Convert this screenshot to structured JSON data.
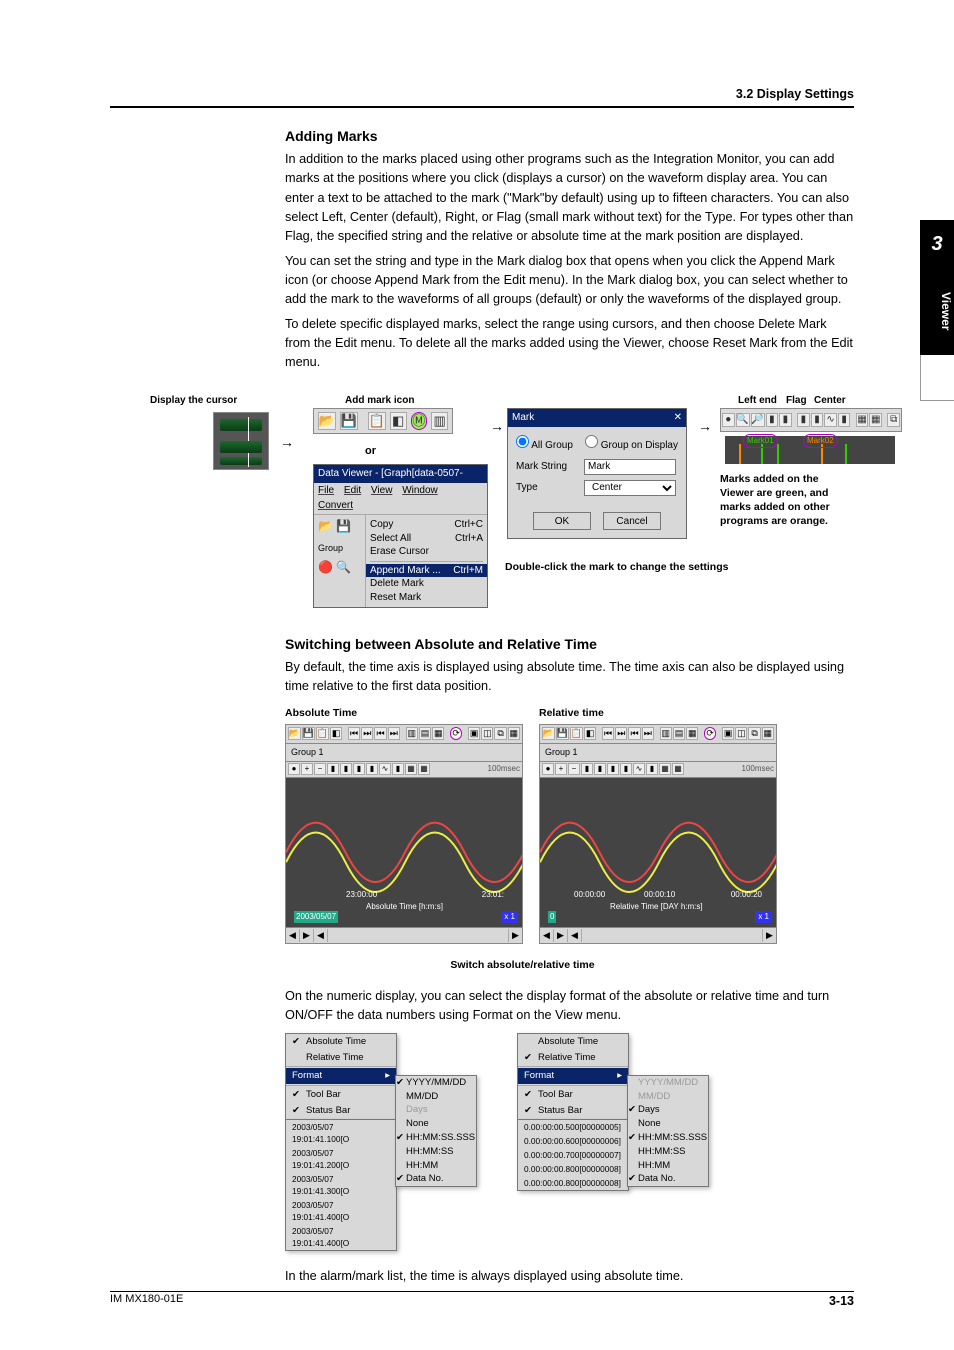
{
  "breadcrumb": "3.2  Display Settings",
  "chapter_tab": {
    "number": "3",
    "label": "Viewer"
  },
  "section1": {
    "heading": "Adding Marks",
    "p1": "In addition to the marks placed using other programs such as the Integration Monitor, you can add marks at the positions where you click (displays a cursor) on the waveform display area. You can enter a text to be attached to the mark (\"Mark\"by default) using up to fifteen characters. You can also select Left, Center (default), Right, or Flag (small mark without text) for the Type. For types other than Flag, the specified string and the relative or absolute time at the mark position are displayed.",
    "p2": "You can set the string and type in the Mark dialog box that opens when you click the Append Mark icon (or choose Append Mark from the Edit menu). In the Mark dialog box, you can select whether to add the mark to the waveforms of all groups (default) or only the waveforms of the displayed group.",
    "p3": "To delete specific displayed marks, select the range using cursors, and then choose Delete Mark from the Edit menu. To delete all the marks added using the Viewer, choose Reset Mark from the Edit menu."
  },
  "fig1": {
    "labels": {
      "display_cursor": "Display the cursor",
      "add_mark_icon": "Add mark icon",
      "left_end": "Left end",
      "flag": "Flag",
      "center": "Center",
      "or": "or"
    },
    "toolbar1_icons": [
      "open-icon",
      "save-icon",
      "copy-icon",
      "auto-icon",
      "mark-icon",
      "grid-icon"
    ],
    "menu": {
      "title": "Data Viewer - [Graph[data-0507-",
      "menubar": [
        "File",
        "Edit",
        "View",
        "Window",
        "Convert"
      ],
      "items": [
        {
          "label": "Copy",
          "accel": "Ctrl+C"
        },
        {
          "label": "Select All",
          "accel": "Ctrl+A"
        },
        {
          "label": "Erase Cursor",
          "accel": ""
        }
      ],
      "highlight": {
        "label": "Append Mark ...",
        "accel": "Ctrl+M"
      },
      "items2": [
        {
          "label": "Delete Mark",
          "accel": ""
        },
        {
          "label": "Reset Mark",
          "accel": ""
        }
      ],
      "group": "Group"
    },
    "dialog": {
      "title": "Mark",
      "all_group": "All Group",
      "group_on_display": "Group on Display",
      "mark_string_label": "Mark String",
      "mark_string_value": "Mark",
      "type_label": "Type",
      "type_value": "Center",
      "ok": "OK",
      "cancel": "Cancel"
    },
    "caption1": "Marks added on the Viewer are green, and marks added on other programs are orange.",
    "caption2": "Double-click the mark to change the settings"
  },
  "section2": {
    "heading": "Switching between Absolute and Relative Time",
    "p1": "By default, the time axis is displayed using absolute time. The time axis can also be displayed using time relative to the first data position."
  },
  "fig2": {
    "left": {
      "title": "Absolute Time",
      "group": "Group 1",
      "x1": "23:00:00",
      "x2": "23:01:",
      "axis": "Absolute Time [h:m:s]",
      "date": "2003/05/07",
      "rate": "100msec",
      "zoom": "x 1"
    },
    "right": {
      "title": "Relative time",
      "group": "Group 1",
      "x1": "00:00:00",
      "x2": "00:00:10",
      "x3": "00:00:20",
      "axis": "Relative Time [DAY h:m:s]",
      "date": "0",
      "rate": "100msec",
      "zoom": "x 1"
    },
    "caption": "Switch absolute/relative time"
  },
  "section3": {
    "p1": "On the numeric display, you can select the display format of the absolute or relative time and turn ON/OFF the data numbers using Format on the View menu.",
    "p2": "In the alarm/mark list, the time is always displayed using absolute time."
  },
  "fig3": {
    "menuA": {
      "items_top": [
        "Absolute Time",
        "Relative Time"
      ],
      "format": "Format",
      "items_mid": [
        "Tool Bar",
        "Status Bar"
      ],
      "list": [
        "2003/05/07 19:01:41.100[O",
        "2003/05/07 19:01:41.200[O",
        "2003/05/07 19:01:41.300[O",
        "2003/05/07 19:01:41.400[O",
        "2003/05/07 19:01:41.400[O"
      ],
      "sub": [
        "YYYY/MM/DD",
        "MM/DD",
        "Days",
        "None",
        "HH:MM:SS.SSS",
        "HH:MM:SS",
        "HH:MM",
        "Data No."
      ],
      "checked": [
        0,
        4,
        7
      ]
    },
    "menuB": {
      "items_top": [
        "Absolute Time",
        "Relative Time"
      ],
      "format": "Format",
      "items_mid": [
        "Tool Bar",
        "Status Bar"
      ],
      "list": [
        "0.00:00:00.500[00000005]",
        "0.00:00:00.600[00000006]",
        "0.00:00:00.700[00000007]",
        "0.00:00:00.800[00000008]",
        "0.00:00:00.800[00000008]"
      ],
      "sub": [
        "YYYY/MM/DD",
        "MM/DD",
        "Days",
        "None",
        "HH:MM:SS.SSS",
        "HH:MM:SS",
        "HH:MM",
        "Data No."
      ],
      "checked": [
        2,
        4,
        7
      ]
    }
  },
  "footer": {
    "doc": "IM MX180-01E",
    "page": "3-13"
  }
}
